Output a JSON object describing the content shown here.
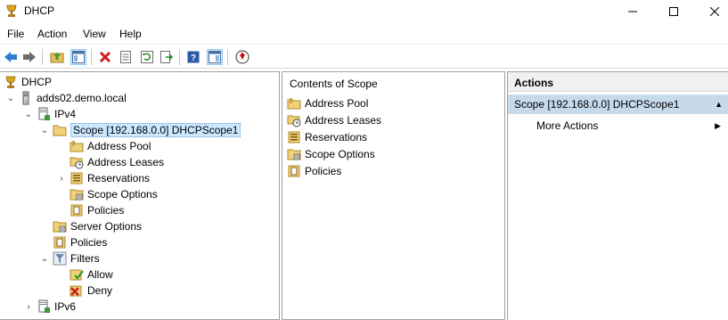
{
  "window": {
    "title": "DHCP",
    "minimize": "—",
    "maximize": "☐",
    "close": "✕"
  },
  "menu": {
    "file": "File",
    "action": "Action",
    "view": "View",
    "help": "Help"
  },
  "tree": {
    "root": "DHCP",
    "server": "adds02.demo.local",
    "ipv4": "IPv4",
    "scope": "Scope [192.168.0.0] DHCPScope1",
    "address_pool": "Address Pool",
    "address_leases": "Address Leases",
    "reservations": "Reservations",
    "scope_options": "Scope Options",
    "scope_policies": "Policies",
    "server_options": "Server Options",
    "policies": "Policies",
    "filters": "Filters",
    "allow": "Allow",
    "deny": "Deny",
    "ipv6": "IPv6"
  },
  "content": {
    "header": "Contents of Scope",
    "items": [
      "Address Pool",
      "Address Leases",
      "Reservations",
      "Scope Options",
      "Policies"
    ]
  },
  "actions": {
    "header": "Actions",
    "group": "Scope [192.168.0.0] DHCPScope1",
    "more": "More Actions"
  }
}
